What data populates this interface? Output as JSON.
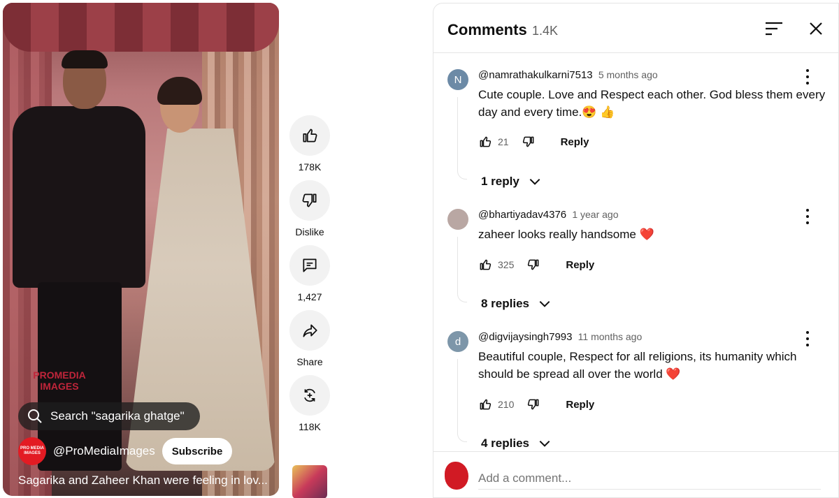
{
  "video": {
    "watermark": "PROMEDIA\nIMAGES",
    "search_label": "Search \"sagarika ghatge\"",
    "channel_avatar_text": "PRO MEDIA IMAGES",
    "channel_name": "@ProMediaImages",
    "subscribe_label": "Subscribe",
    "caption": "Sagarika and Zaheer Khan were feeling in lov..."
  },
  "actions": {
    "like_count": "178K",
    "dislike_label": "Dislike",
    "comments_count": "1,427",
    "share_label": "Share",
    "remix_count": "118K"
  },
  "comments_panel": {
    "title": "Comments",
    "count": "1.4K",
    "add_placeholder": "Add a comment...",
    "items": [
      {
        "avatar_letter": "N",
        "avatar_color": "#6c8aa6",
        "user": "@namrathakulkarni7513",
        "time": "5 months ago",
        "text": "Cute couple. Love and Respect each other. God bless them every day and every time.😍 👍",
        "likes": "21",
        "reply_label": "Reply",
        "replies": "1 reply"
      },
      {
        "avatar_letter": "",
        "avatar_color": "#b9a7a3",
        "user": "@bhartiyadav4376",
        "time": "1 year ago",
        "text": "zaheer looks really handsome ❤️",
        "likes": "325",
        "reply_label": "Reply",
        "replies": "8 replies"
      },
      {
        "avatar_letter": "d",
        "avatar_color": "#7d96a9",
        "user": "@digvijaysingh7993",
        "time": "11 months ago",
        "text": "Beautiful couple, Respect for all religions, its humanity which should be spread all over the world ❤️",
        "likes": "210",
        "reply_label": "Reply",
        "replies": "4 replies"
      }
    ]
  }
}
